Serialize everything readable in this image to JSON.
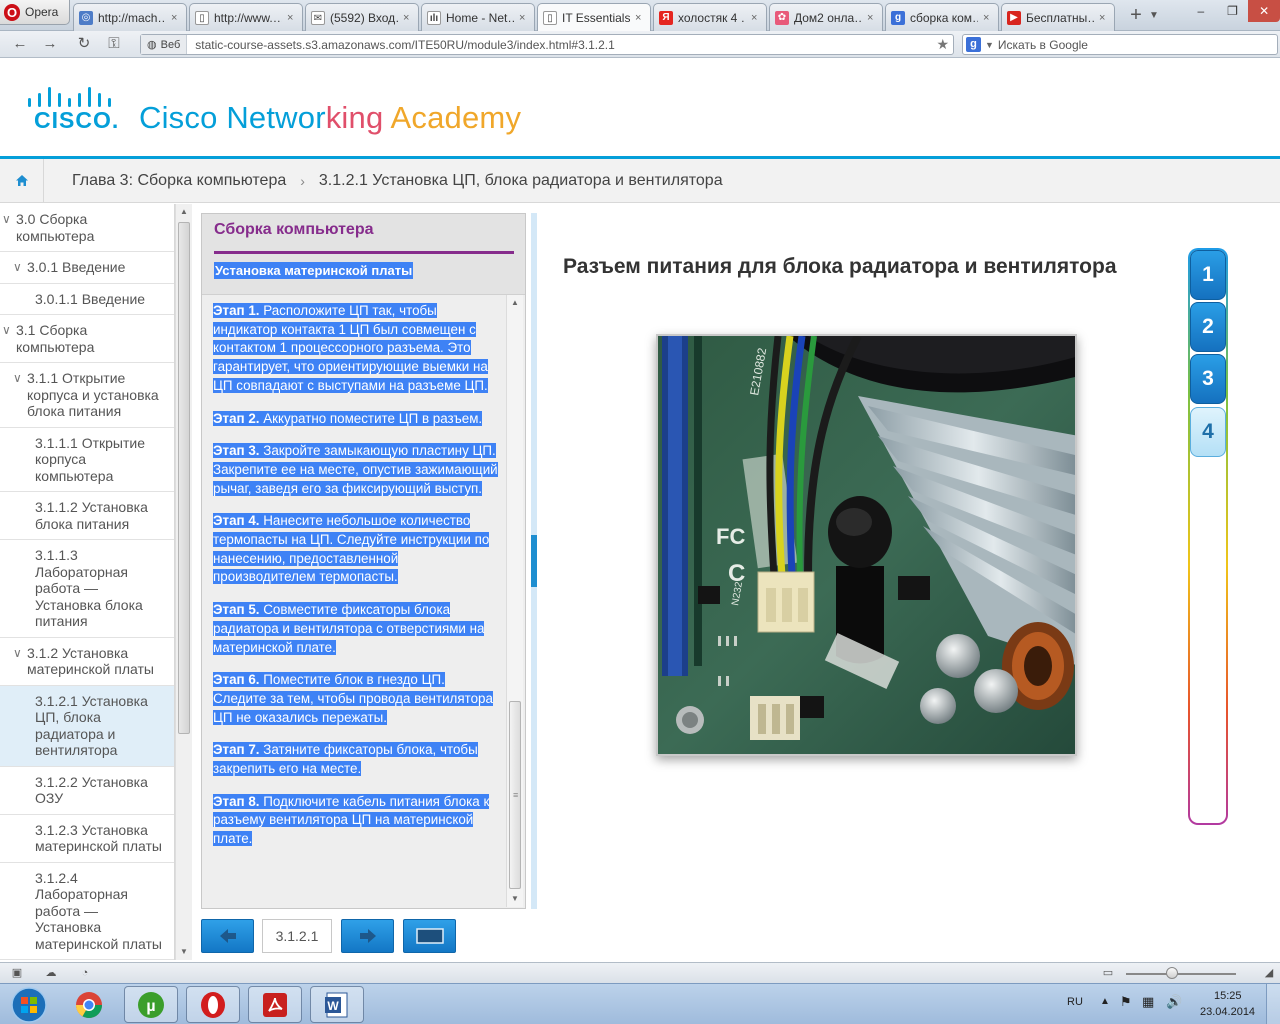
{
  "browser": {
    "menu_label": "Opera",
    "tabs": [
      {
        "label": "http://mach…",
        "icon_color": "#4d7cc7",
        "icon": "ring-icon"
      },
      {
        "label": "http://www.…",
        "icon_color": "#ffffff",
        "icon": "page-icon"
      },
      {
        "label": "(5592) Вход…",
        "icon_color": "#ffffff",
        "icon": "mail-icon"
      },
      {
        "label": "Home - Net…",
        "icon_color": "#ffffff",
        "icon": "cisco-icon"
      },
      {
        "label": "IT Essentials",
        "icon_color": "#ffffff",
        "icon": "page-icon"
      },
      {
        "label": "холостяк 4 …",
        "icon_color": "#e52620",
        "icon": "yandex-icon"
      },
      {
        "label": "Дом2 онла…",
        "icon_color": "#e85a7a",
        "icon": "flower-icon"
      },
      {
        "label": "сборка ком…",
        "icon_color": "#3b70d8",
        "icon": "google-icon"
      },
      {
        "label": "Бесплатны…",
        "icon_color": "#d8251e",
        "icon": "youtube-icon"
      }
    ],
    "active_tab": 4,
    "web_badge": "Веб",
    "url": "static-course-assets.s3.amazonaws.com/ITE50RU/module3/index.html#3.1.2.1",
    "search_placeholder": "Искать в Google"
  },
  "header": {
    "cisco_word": "CISCO.",
    "academy_parts": [
      {
        "text": "Cisco Networ",
        "color": "#049fd9"
      },
      {
        "text": "king ",
        "color": "#e04f6a"
      },
      {
        "text": "Academy",
        "color": "#f0a72a"
      }
    ]
  },
  "breadcrumb": {
    "chapter": "Глава 3: Сборка компьютера",
    "separator": "›",
    "current": "3.1.2.1 Установка ЦП, блока радиатора и вентилятора"
  },
  "toc": [
    {
      "label": "3.0 Сборка компьютера",
      "indent": 0,
      "arrow": true,
      "active": false
    },
    {
      "label": "3.0.1 Введение",
      "indent": 1,
      "arrow": true,
      "active": false
    },
    {
      "label": "3.0.1.1 Введение",
      "indent": 2,
      "arrow": false,
      "active": false
    },
    {
      "label": "3.1 Сборка компьютера",
      "indent": 0,
      "arrow": true,
      "active": false
    },
    {
      "label": "3.1.1 Открытие корпуса и установка блока питания",
      "indent": 1,
      "arrow": true,
      "active": false
    },
    {
      "label": "3.1.1.1 Открытие корпуса компьютера",
      "indent": 2,
      "arrow": false,
      "active": false
    },
    {
      "label": "3.1.1.2 Установка блока питания",
      "indent": 2,
      "arrow": false,
      "active": false
    },
    {
      "label": "3.1.1.3 Лабораторная работа — Установка блока питания",
      "indent": 2,
      "arrow": false,
      "active": false
    },
    {
      "label": "3.1.2 Установка материнской платы",
      "indent": 1,
      "arrow": true,
      "active": false
    },
    {
      "label": "3.1.2.1 Установка ЦП, блока радиатора и вентилятора",
      "indent": 2,
      "arrow": false,
      "active": true
    },
    {
      "label": "3.1.2.2 Установка ОЗУ",
      "indent": 2,
      "arrow": false,
      "active": false
    },
    {
      "label": "3.1.2.3 Установка материнской платы",
      "indent": 2,
      "arrow": false,
      "active": false
    },
    {
      "label": "3.1.2.4 Лабораторная работа — Установка материнской платы",
      "indent": 2,
      "arrow": false,
      "active": false
    }
  ],
  "panel": {
    "title": "Сборка компьютера",
    "subtitle": "Установка материнской платы",
    "steps": [
      {
        "label": "Этап 1.",
        "text": "Расположите ЦП так, чтобы индикатор контакта 1 ЦП был совмещен с контактом 1 процессорного разъема. Это гарантирует, что ориентирующие выемки на ЦП совпадают с выступами на разъеме ЦП."
      },
      {
        "label": "Этап 2.",
        "text": "Аккуратно поместите ЦП в разъем."
      },
      {
        "label": "Этап 3.",
        "text": "Закройте замыкающую пластину ЦП. Закрепите ее на месте, опустив зажимающий рычаг, заведя его за фиксирующий выступ."
      },
      {
        "label": "Этап 4.",
        "text": "Нанесите небольшое количество термопасты на ЦП. Следуйте инструкции по нанесению, предоставленной производителем термопасты."
      },
      {
        "label": "Этап 5.",
        "text": "Совместите фиксаторы блока радиатора и вентилятора с отверстиями на материнской плате."
      },
      {
        "label": "Этап 6.",
        "text": "Поместите блок в гнездо ЦП. Следите за тем, чтобы провода вентилятора ЦП не оказались пережаты."
      },
      {
        "label": "Этап 7.",
        "text": "Затяните фиксаторы блока, чтобы закрепить его на месте."
      },
      {
        "label": "Этап 8.",
        "text": "Подключите кабель питания блока к разъему вентилятора ЦП на материнской плате."
      }
    ]
  },
  "nav": {
    "page_number": "3.1.2.1"
  },
  "media": {
    "title": "Разъем питания для блока радиатора и вентилятора",
    "board_texts": [
      "E210882",
      "FC",
      "C",
      "N232"
    ]
  },
  "slides": [
    {
      "label": "1",
      "current": false
    },
    {
      "label": "2",
      "current": false
    },
    {
      "label": "3",
      "current": false
    },
    {
      "label": "4",
      "current": true
    }
  ],
  "taskbar": {
    "language": "RU",
    "time": "15:25",
    "date": "23.04.2014"
  },
  "colors": {
    "accent_blue": "#049fd9",
    "panel_purple": "#862c8c",
    "selection_blue": "#3e82f5"
  }
}
